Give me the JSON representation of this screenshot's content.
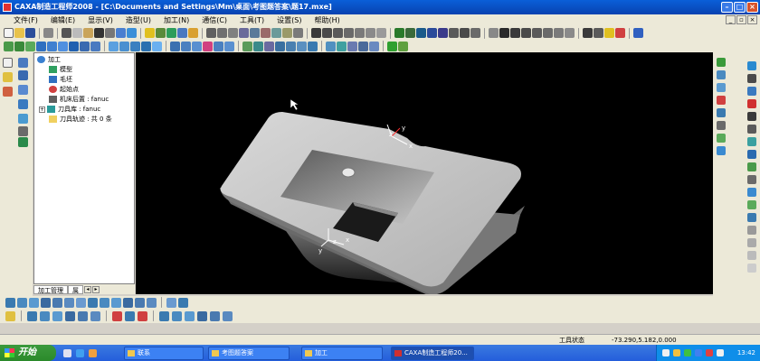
{
  "window": {
    "title": "CAXA制造工程师2008  - [C:\\Documents and Settings\\Mm\\桌面\\考图题答案\\题17.mxe]"
  },
  "menu": {
    "items": [
      "文件(F)",
      "编辑(E)",
      "显示(V)",
      "造型(U)",
      "加工(N)",
      "通信(C)",
      "工具(T)",
      "设置(S)",
      "帮助(H)"
    ]
  },
  "tree": {
    "items": [
      {
        "label": "加工",
        "icon": "gear-icon"
      },
      {
        "label": "模型",
        "icon": "model-icon"
      },
      {
        "label": "毛坯",
        "icon": "stock-icon"
      },
      {
        "label": "起始点",
        "icon": "start-point-icon"
      },
      {
        "label": "机床后置 : fanuc",
        "icon": "machine-icon"
      },
      {
        "label": "刀具库 : fanuc",
        "icon": "tool-library-icon",
        "expander": "+"
      },
      {
        "label": "刀具轨迹 : 共 0 条",
        "icon": "folder-icon"
      }
    ],
    "tabs": [
      "加工管理",
      "属"
    ]
  },
  "viewport": {
    "background": "#000000"
  },
  "axes": {
    "top": {
      "x": "x",
      "y": "y",
      "z": "z"
    },
    "bottom": {
      "x": "x",
      "y": "y",
      "z": "z"
    }
  },
  "status": {
    "mode": "工具状态",
    "coords": "-73.290,5.182,0.000"
  },
  "taskbar": {
    "start": "开始",
    "tasks": [
      {
        "label": "联系",
        "active": false
      },
      {
        "label": "考图题答案",
        "active": false
      },
      {
        "label": "加工",
        "active": false
      },
      {
        "label": "CAXA制造工程师20...",
        "active": true
      }
    ],
    "clock": "13:42"
  },
  "colors": {
    "titlebar": "#0842b0",
    "toolbar": "#ece9d8",
    "taskbar": "#245edb",
    "part": "#c8c8c8"
  }
}
